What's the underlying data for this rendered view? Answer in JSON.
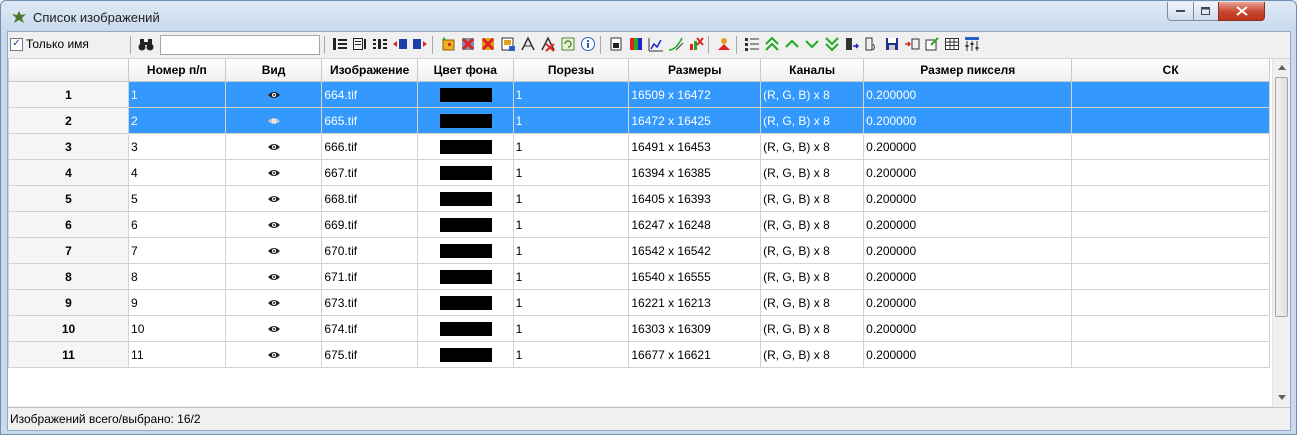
{
  "window": {
    "title": "Список изображений"
  },
  "toolbar": {
    "only_name_label": "Только имя",
    "only_name_checked": true,
    "search_value": "",
    "tools": [
      "list-lines-icon",
      "list-cols-icon",
      "list-grid-icon",
      "move-left-icon",
      "move-right-icon",
      "add-image-icon",
      "delete-image-icon",
      "delete-all-icon",
      "image-props-icon",
      "crop-icon",
      "crop-delete-icon",
      "refresh-icon",
      "info-icon",
      "page-icon",
      "color-channels-icon",
      "histogram-icon",
      "curve-icon",
      "remove-channel-icon",
      "person-icon",
      "numbering-icon",
      "move-top-icon",
      "move-up-icon",
      "move-down-icon",
      "move-bottom-icon",
      "export-icon",
      "import-icon",
      "save-icon",
      "insert-icon",
      "edit-icon",
      "table-icon",
      "settings-icon"
    ]
  },
  "table": {
    "columns": [
      "Номер п/п",
      "Вид",
      "Изображение",
      "Цвет фона",
      "Порезы",
      "Размеры",
      "Каналы",
      "Размер пикселя",
      "СК"
    ],
    "rows": [
      {
        "row": "1",
        "num": "1",
        "image": "664.tif",
        "bg": "#000000",
        "cuts": "1",
        "size": "16509 x 16472",
        "channels": "(R, G, B) x 8",
        "pixel": "0.200000",
        "sk": "",
        "selected": true,
        "eye_dim": false
      },
      {
        "row": "2",
        "num": "2",
        "image": "665.tif",
        "bg": "#000000",
        "cuts": "1",
        "size": "16472 x 16425",
        "channels": "(R, G, B) x 8",
        "pixel": "0.200000",
        "sk": "",
        "selected": true,
        "eye_dim": true
      },
      {
        "row": "3",
        "num": "3",
        "image": "666.tif",
        "bg": "#000000",
        "cuts": "1",
        "size": "16491 x 16453",
        "channels": "(R, G, B) x 8",
        "pixel": "0.200000",
        "sk": "",
        "selected": false,
        "eye_dim": false
      },
      {
        "row": "4",
        "num": "4",
        "image": "667.tif",
        "bg": "#000000",
        "cuts": "1",
        "size": "16394 x 16385",
        "channels": "(R, G, B) x 8",
        "pixel": "0.200000",
        "sk": "",
        "selected": false,
        "eye_dim": false
      },
      {
        "row": "5",
        "num": "5",
        "image": "668.tif",
        "bg": "#000000",
        "cuts": "1",
        "size": "16405 x 16393",
        "channels": "(R, G, B) x 8",
        "pixel": "0.200000",
        "sk": "",
        "selected": false,
        "eye_dim": false
      },
      {
        "row": "6",
        "num": "6",
        "image": "669.tif",
        "bg": "#000000",
        "cuts": "1",
        "size": "16247 x 16248",
        "channels": "(R, G, B) x 8",
        "pixel": "0.200000",
        "sk": "",
        "selected": false,
        "eye_dim": false
      },
      {
        "row": "7",
        "num": "7",
        "image": "670.tif",
        "bg": "#000000",
        "cuts": "1",
        "size": "16542 x 16542",
        "channels": "(R, G, B) x 8",
        "pixel": "0.200000",
        "sk": "",
        "selected": false,
        "eye_dim": false
      },
      {
        "row": "8",
        "num": "8",
        "image": "671.tif",
        "bg": "#000000",
        "cuts": "1",
        "size": "16540 x 16555",
        "channels": "(R, G, B) x 8",
        "pixel": "0.200000",
        "sk": "",
        "selected": false,
        "eye_dim": false
      },
      {
        "row": "9",
        "num": "9",
        "image": "673.tif",
        "bg": "#000000",
        "cuts": "1",
        "size": "16221 x 16213",
        "channels": "(R, G, B) x 8",
        "pixel": "0.200000",
        "sk": "",
        "selected": false,
        "eye_dim": false
      },
      {
        "row": "10",
        "num": "10",
        "image": "674.tif",
        "bg": "#000000",
        "cuts": "1",
        "size": "16303 x 16309",
        "channels": "(R, G, B) x 8",
        "pixel": "0.200000",
        "sk": "",
        "selected": false,
        "eye_dim": false
      },
      {
        "row": "11",
        "num": "11",
        "image": "675.tif",
        "bg": "#000000",
        "cuts": "1",
        "size": "16677 x 16621",
        "channels": "(R, G, B) x 8",
        "pixel": "0.200000",
        "sk": "",
        "selected": false,
        "eye_dim": false
      }
    ]
  },
  "status": {
    "text": "Изображений всего/выбрано: 16/2"
  },
  "colors": {
    "selection": "#3399ff",
    "accent_green": "#22aa22",
    "accent_red": "#cc2222"
  }
}
